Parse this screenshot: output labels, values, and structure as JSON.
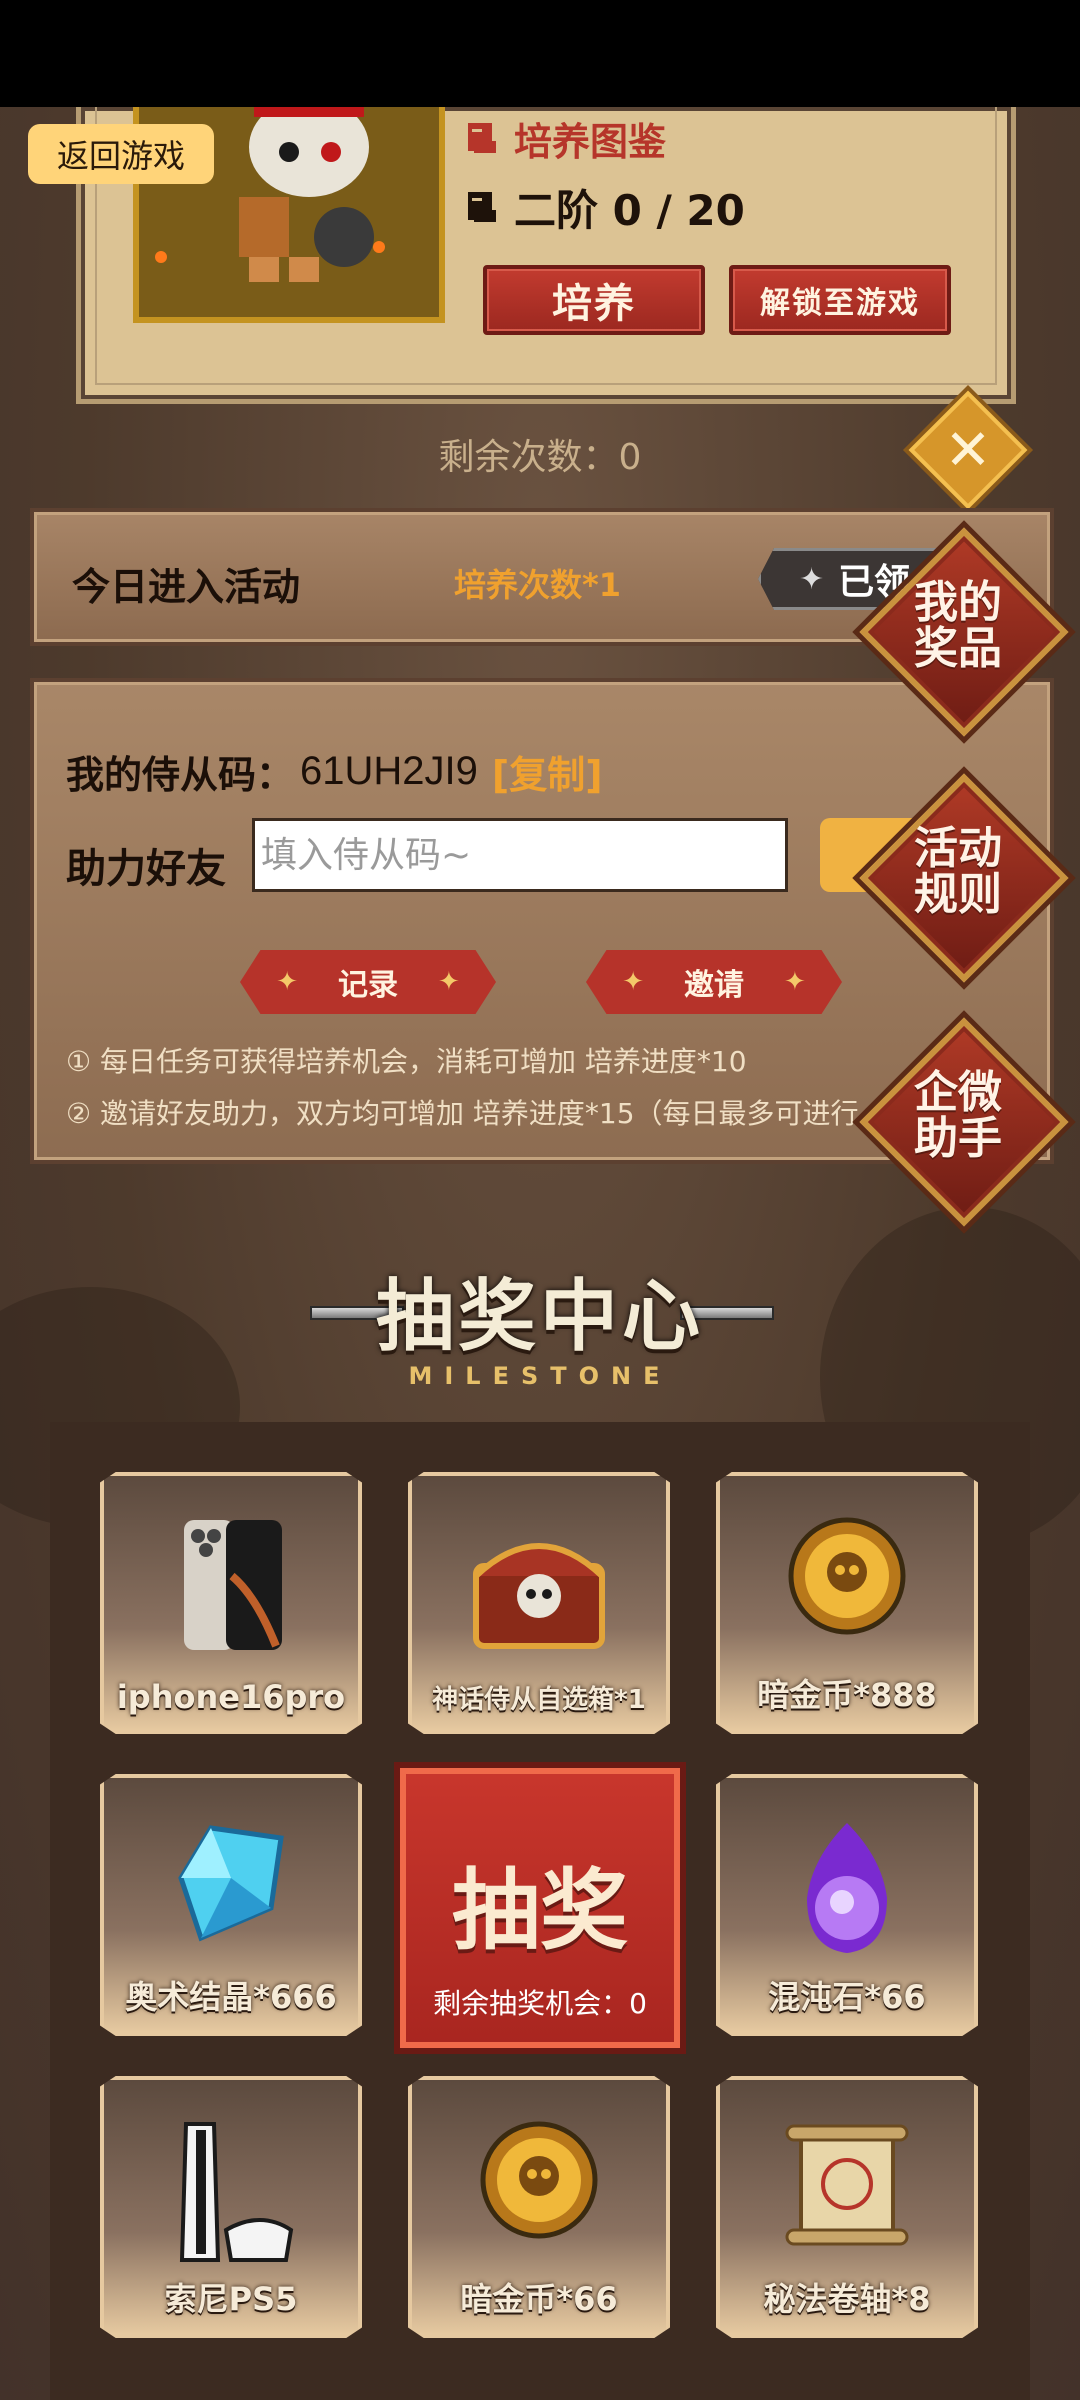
{
  "top_card": {
    "title": "培养图鉴",
    "stage": "二阶 0 / 20",
    "train_button": "培养",
    "unlock_button": "解锁至游戏"
  },
  "back_button": "返回游戏",
  "remaining_times": "剩余次数：0",
  "today": {
    "title": "今日进入活动",
    "reward": "培养次数*1",
    "status": "已领"
  },
  "invite": {
    "code_label": "我的侍从码：",
    "code_value": "61UH2JI9",
    "copy": "[复制]",
    "help_label": "助力好友",
    "input_placeholder": "填入侍从码~",
    "record_button": "记录",
    "invite_button": "邀请",
    "note1": "① 每日任务可获得培养机会，消耗可增加 培养进度*10",
    "note2": "② 邀请好友助力，双方均可增加 培养进度*15（每日最多可进行"
  },
  "side": {
    "prizes_line1": "我的",
    "prizes_line2": "奖品",
    "rules_line1": "活动",
    "rules_line2": "规则",
    "wechat_line1": "企微",
    "wechat_line2": "助手"
  },
  "lottery": {
    "title": "抽奖中心",
    "subtitle": "MILESTONE",
    "draw_label": "抽奖",
    "draw_remaining": "剩余抽奖机会：0",
    "prizes": [
      {
        "label": "iphone16pro",
        "icon": "phone-icon"
      },
      {
        "label": "神话侍从自选箱*1",
        "icon": "chest-icon"
      },
      {
        "label": "暗金币*888",
        "icon": "coin-icon"
      },
      {
        "label": "奥术结晶*666",
        "icon": "crystal-icon"
      },
      {
        "label": "混沌石*66",
        "icon": "flame-orb-icon"
      },
      {
        "label": "索尼PS5",
        "icon": "console-icon"
      },
      {
        "label": "暗金币*66",
        "icon": "coin-icon"
      },
      {
        "label": "秘法卷轴*8",
        "icon": "scroll-icon"
      }
    ]
  },
  "colors": {
    "accent_red": "#b6352a",
    "accent_gold": "#f0a12e",
    "back_button_bg": "#ffd479"
  }
}
